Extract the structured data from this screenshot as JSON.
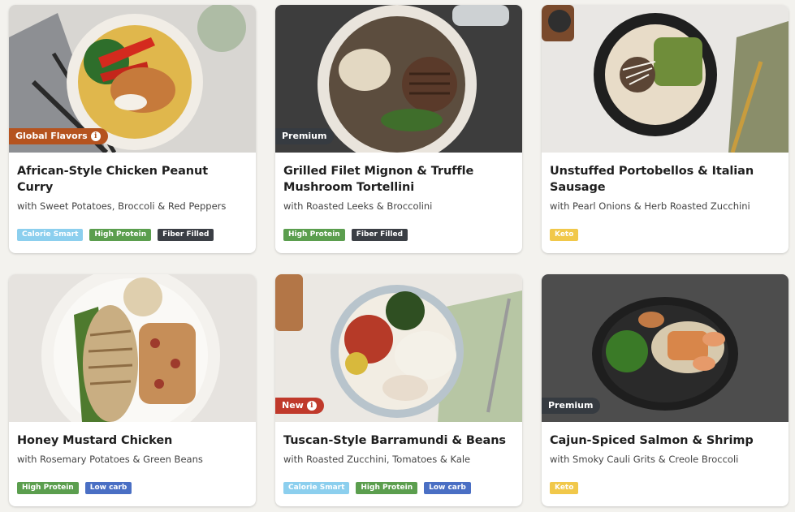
{
  "meals": [
    {
      "title": "African-Style Chicken Peanut Curry",
      "subtitle": "with Sweet Potatoes, Broccoli & Red Peppers",
      "flag": "Global Flavors",
      "tags": [
        "Calorie Smart",
        "High Protein",
        "Fiber Filled"
      ]
    },
    {
      "title": "Grilled Filet Mignon & Truffle Mushroom Tortellini",
      "subtitle": "with Roasted Leeks & Broccolini",
      "flag": "Premium",
      "tags": [
        "High Protein",
        "Fiber Filled"
      ]
    },
    {
      "title": "Unstuffed Portobellos & Italian Sausage",
      "subtitle": "with Pearl Onions & Herb Roasted Zucchini",
      "flag": "",
      "tags": [
        "Keto"
      ]
    },
    {
      "title": "Honey Mustard Chicken",
      "subtitle": "with Rosemary Potatoes & Green Beans",
      "flag": "",
      "tags": [
        "High Protein",
        "Low carb"
      ]
    },
    {
      "title": "Tuscan-Style Barramundi & Beans",
      "subtitle": "with Roasted Zucchini, Tomatoes & Kale",
      "flag": "New",
      "tags": [
        "Calorie Smart",
        "High Protein",
        "Low carb"
      ]
    },
    {
      "title": "Cajun-Spiced Salmon & Shrimp",
      "subtitle": "with Smoky Cauli Grits & Creole Broccoli",
      "flag": "Premium",
      "tags": [
        "Keto"
      ]
    }
  ],
  "tag_colors": {
    "Calorie Smart": "#8ccfee",
    "High Protein": "#5b9e4e",
    "Fiber Filled": "#3b3f45",
    "Keto": "#f1c84a",
    "Low carb": "#4a6fc4"
  },
  "flag_colors": {
    "Global Flavors": "#b5531f",
    "Premium": "#363b41",
    "New": "#c0392b"
  },
  "flag_icons": {
    "Global Flavors": "info-icon",
    "New": "info-icon"
  },
  "photo_backgrounds": [
    "#d8d6d2",
    "#3d3d3d",
    "#e9e7e4",
    "#e6e3df",
    "#ebe8e3",
    "#4d4d4d"
  ]
}
